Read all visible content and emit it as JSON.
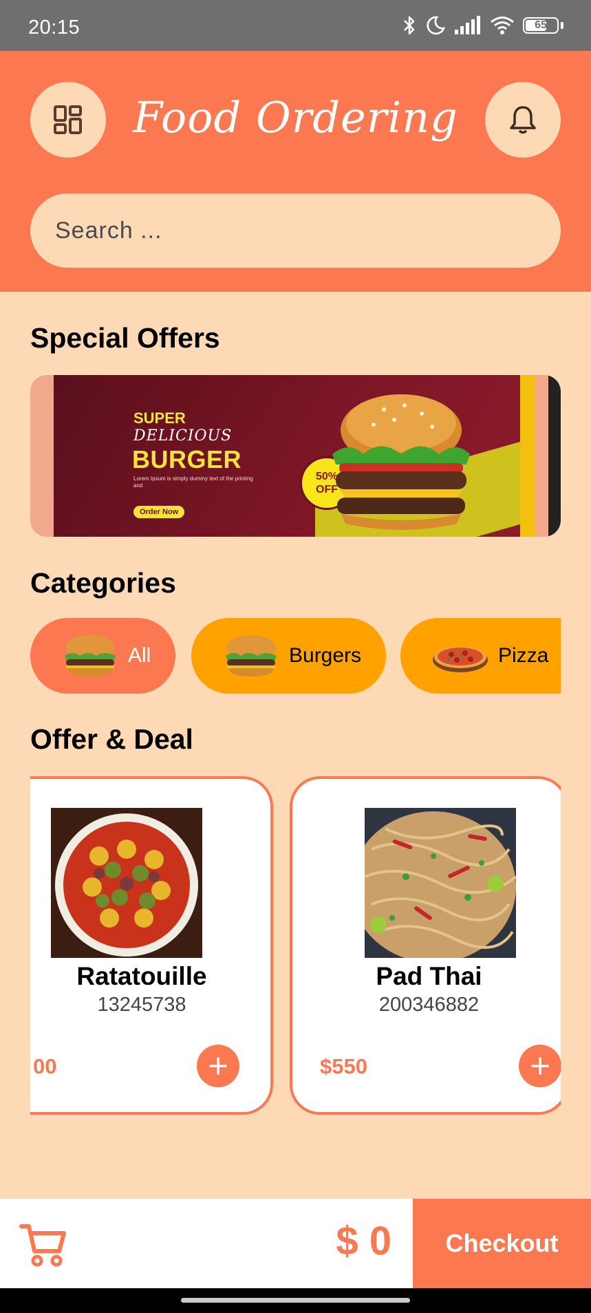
{
  "status_bar": {
    "time": "20:15",
    "battery": "65",
    "icons": [
      "bluetooth-icon",
      "moon-icon",
      "signal-icon",
      "wifi-icon",
      "battery-icon"
    ]
  },
  "header": {
    "title": "Food Ordering",
    "menu_icon": "grid-menu-icon",
    "notification_icon": "bell-icon",
    "search_placeholder": "Search ..."
  },
  "special_offers": {
    "heading": "Special Offers",
    "banner": {
      "line1": "SUPER",
      "line2": "DELICIOUS",
      "line3": "BURGER",
      "body": "Lorem Ipsum is simply dummy text of the printing and",
      "cta": "Order Now",
      "badge_top": "50%",
      "badge_bottom": "OFF"
    }
  },
  "categories": {
    "heading": "Categories",
    "items": [
      {
        "label": "All",
        "icon": "burger-icon",
        "active": true
      },
      {
        "label": "Burgers",
        "icon": "burger-icon",
        "active": false
      },
      {
        "label": "Pizza",
        "icon": "pizza-icon",
        "active": false
      }
    ]
  },
  "offer_deal": {
    "heading": "Offer & Deal",
    "items": [
      {
        "name": "Ratatouille",
        "id": "13245738",
        "price": "00"
      },
      {
        "name": "Pad Thai",
        "id": "200346882",
        "price": "$550"
      }
    ]
  },
  "bottom_bar": {
    "cart_icon": "cart-icon",
    "total": "$ 0",
    "checkout_label": "Checkout"
  },
  "colors": {
    "primary": "#fc7850",
    "background": "#fdd9b6",
    "category_inactive": "#ffa200"
  }
}
